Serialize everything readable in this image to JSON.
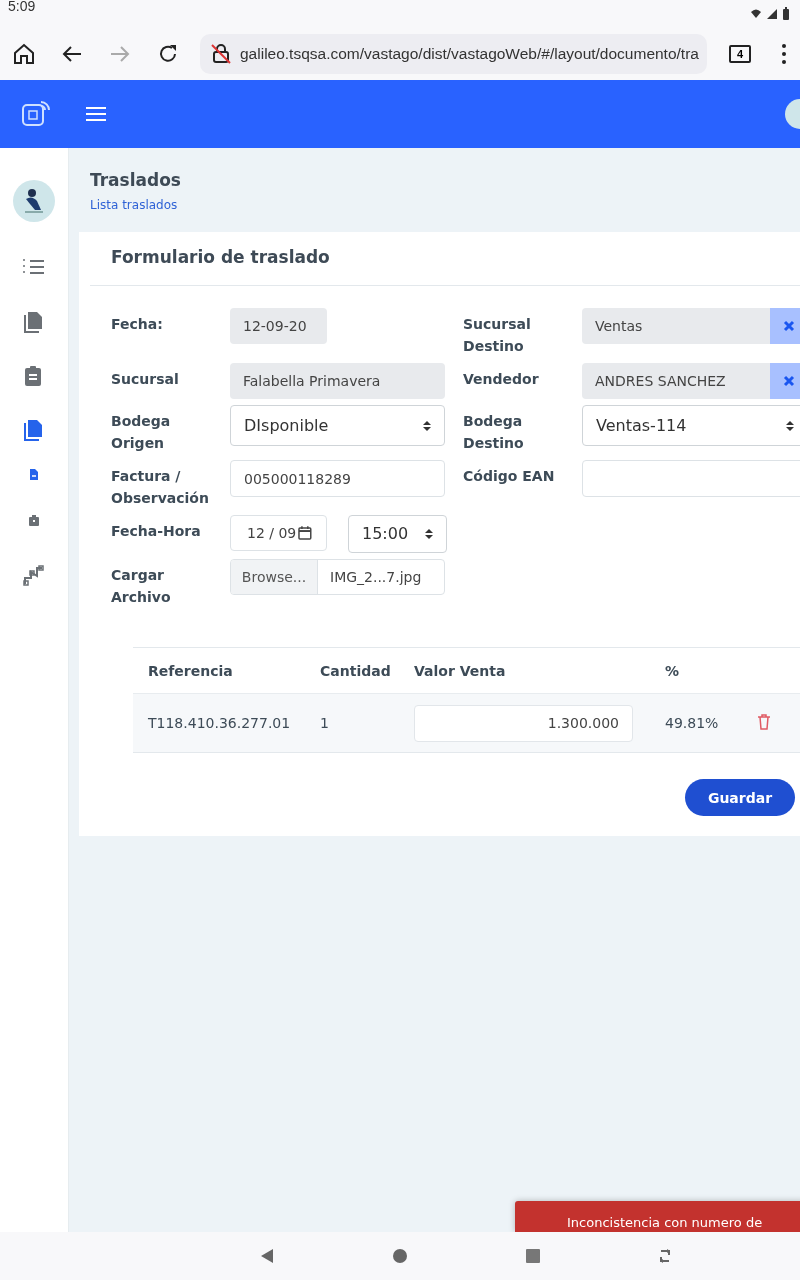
{
  "status_bar": {
    "time": "5:09"
  },
  "browser": {
    "url": "galileo.tsqsa.com/vastago/dist/vastagoWeb/#/layout/documento/tra",
    "tab_count": "4",
    "forward_disabled": true
  },
  "sidebar": {
    "items": [
      {
        "kind": "item",
        "selected": false
      },
      {
        "kind": "item",
        "selected": false
      },
      {
        "kind": "item",
        "selected": false
      },
      {
        "kind": "item",
        "selected": true
      },
      {
        "kind": "subitem",
        "selected": true
      },
      {
        "kind": "subitem",
        "selected": false
      },
      {
        "kind": "item",
        "selected": false
      }
    ]
  },
  "page": {
    "title": "Traslados",
    "breadcrumb": "Lista traslados"
  },
  "form": {
    "title": "Formulario de traslado",
    "rows": [
      [
        {
          "label": "Fecha:",
          "controls": [
            {
              "kind": "readonly_short",
              "value": "12-09-20"
            }
          ]
        },
        {
          "label": "Sucursal Destino",
          "controls": [
            {
              "kind": "clearable",
              "value": "Ventas"
            }
          ]
        }
      ],
      [
        {
          "label": "Sucursal",
          "controls": [
            {
              "kind": "readonly",
              "value": "Falabella Primavera"
            }
          ]
        },
        {
          "label": "Vendedor",
          "controls": [
            {
              "kind": "clearable",
              "value": "ANDRES SANCHEZ"
            }
          ]
        }
      ],
      [
        {
          "label": "Bodega Origen",
          "controls": [
            {
              "kind": "select",
              "value": "DIsponible"
            }
          ]
        },
        {
          "label": "Bodega Destino",
          "controls": [
            {
              "kind": "select",
              "value": "Ventas-114"
            }
          ]
        }
      ],
      [
        {
          "label": "Factura / Observación",
          "controls": [
            {
              "kind": "text",
              "value": "005000118289"
            }
          ]
        },
        {
          "label": "Código EAN",
          "controls": [
            {
              "kind": "text"
            }
          ]
        }
      ],
      [
        {
          "label": "Fecha-Hora",
          "controls": [
            {
              "kind": "date",
              "value": "12 / 09"
            },
            {
              "kind": "time",
              "value": "15:00"
            }
          ]
        }
      ],
      [
        {
          "label": "Cargar Archivo",
          "controls": [
            {
              "kind": "file",
              "button": "Browse...",
              "value": "IMG_2...7.jpg"
            }
          ]
        }
      ]
    ]
  },
  "table": {
    "columns": [
      "Referencia",
      "Cantidad",
      "Valor Venta",
      "%"
    ],
    "rows": [
      {
        "referencia": "T118.410.36.277.01",
        "cantidad": "1",
        "valor_venta": "1.300.000",
        "porcentaje": "49.81%"
      }
    ]
  },
  "save_button": "Guardar",
  "toast": {
    "message": "Inconcistencia con numero de"
  }
}
